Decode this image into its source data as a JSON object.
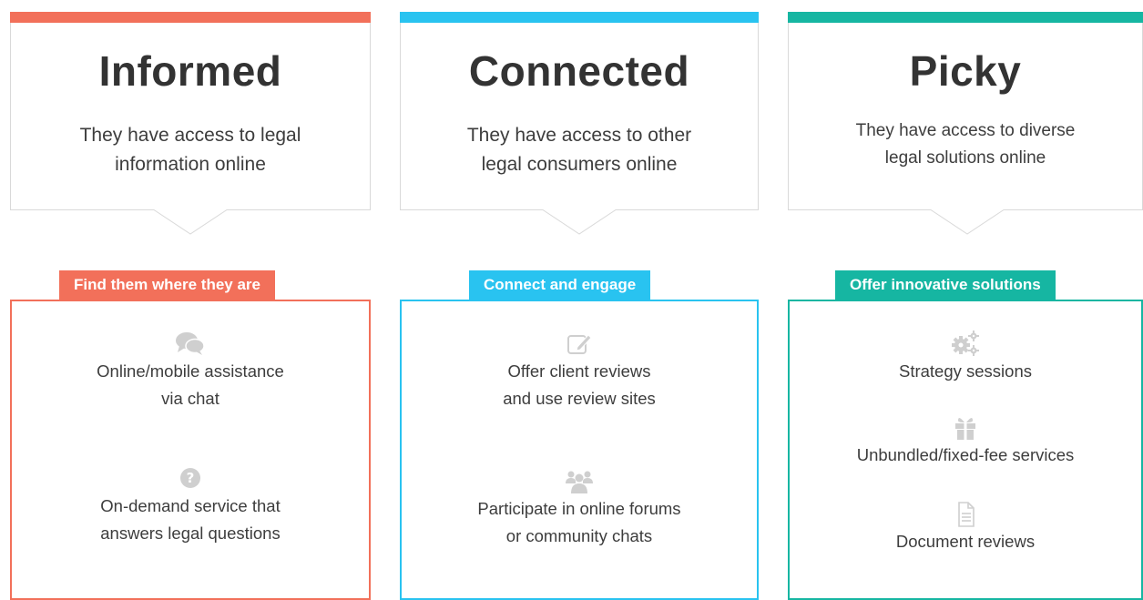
{
  "columns": [
    {
      "color": "#f2705a",
      "title": "Informed",
      "description_lines": [
        "They have access to legal",
        "information online"
      ],
      "tag": "Find them where they are",
      "items": [
        {
          "icon": "chat-bubbles-icon",
          "lines": [
            "Online/mobile assistance",
            "via chat"
          ]
        },
        {
          "icon": "question-circle-icon",
          "lines": [
            "On-demand service that",
            "answers legal questions"
          ]
        }
      ]
    },
    {
      "color": "#29c3f0",
      "title": "Connected",
      "description_lines": [
        "They have access to other",
        "legal consumers online"
      ],
      "tag": "Connect and engage",
      "items": [
        {
          "icon": "edit-icon",
          "lines": [
            "Offer client reviews",
            "and use review sites"
          ]
        },
        {
          "icon": "group-icon",
          "lines": [
            "Participate in online forums",
            "or community chats"
          ]
        }
      ]
    },
    {
      "color": "#16b6a2",
      "title": "Picky",
      "description_lines": [
        "They have access to diverse",
        "legal solutions online"
      ],
      "tag": "Offer innovative solutions",
      "items": [
        {
          "icon": "gears-icon",
          "lines": [
            "Strategy sessions"
          ]
        },
        {
          "icon": "gift-icon",
          "lines": [
            "Unbundled/fixed-fee services"
          ]
        },
        {
          "icon": "document-icon",
          "lines": [
            "Document reviews"
          ]
        }
      ]
    }
  ]
}
